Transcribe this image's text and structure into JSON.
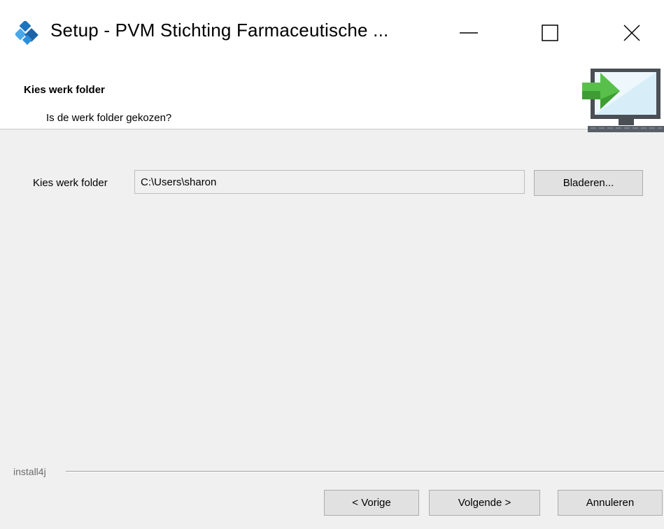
{
  "window": {
    "title": "Setup - PVM Stichting Farmaceutische ...",
    "icons": [
      "app-installer-icon",
      "minimize-icon",
      "maximize-icon",
      "close-icon"
    ]
  },
  "header": {
    "title": "Kies werk folder",
    "subtitle": "Is de werk folder gekozen?",
    "icon": "computer-arrow-icon"
  },
  "form": {
    "label": "Kies werk folder",
    "path_value": "C:\\Users\\sharon",
    "browse_label": "Bladeren..."
  },
  "footer": {
    "brand": "install4j",
    "prev_label": "< Vorige",
    "next_label": "Volgende >",
    "cancel_label": "Annuleren"
  },
  "colors": {
    "accent_blue": "#1e88d6",
    "arrow_green": "#58c04a",
    "dialog_bg": "#f0f0f0"
  }
}
